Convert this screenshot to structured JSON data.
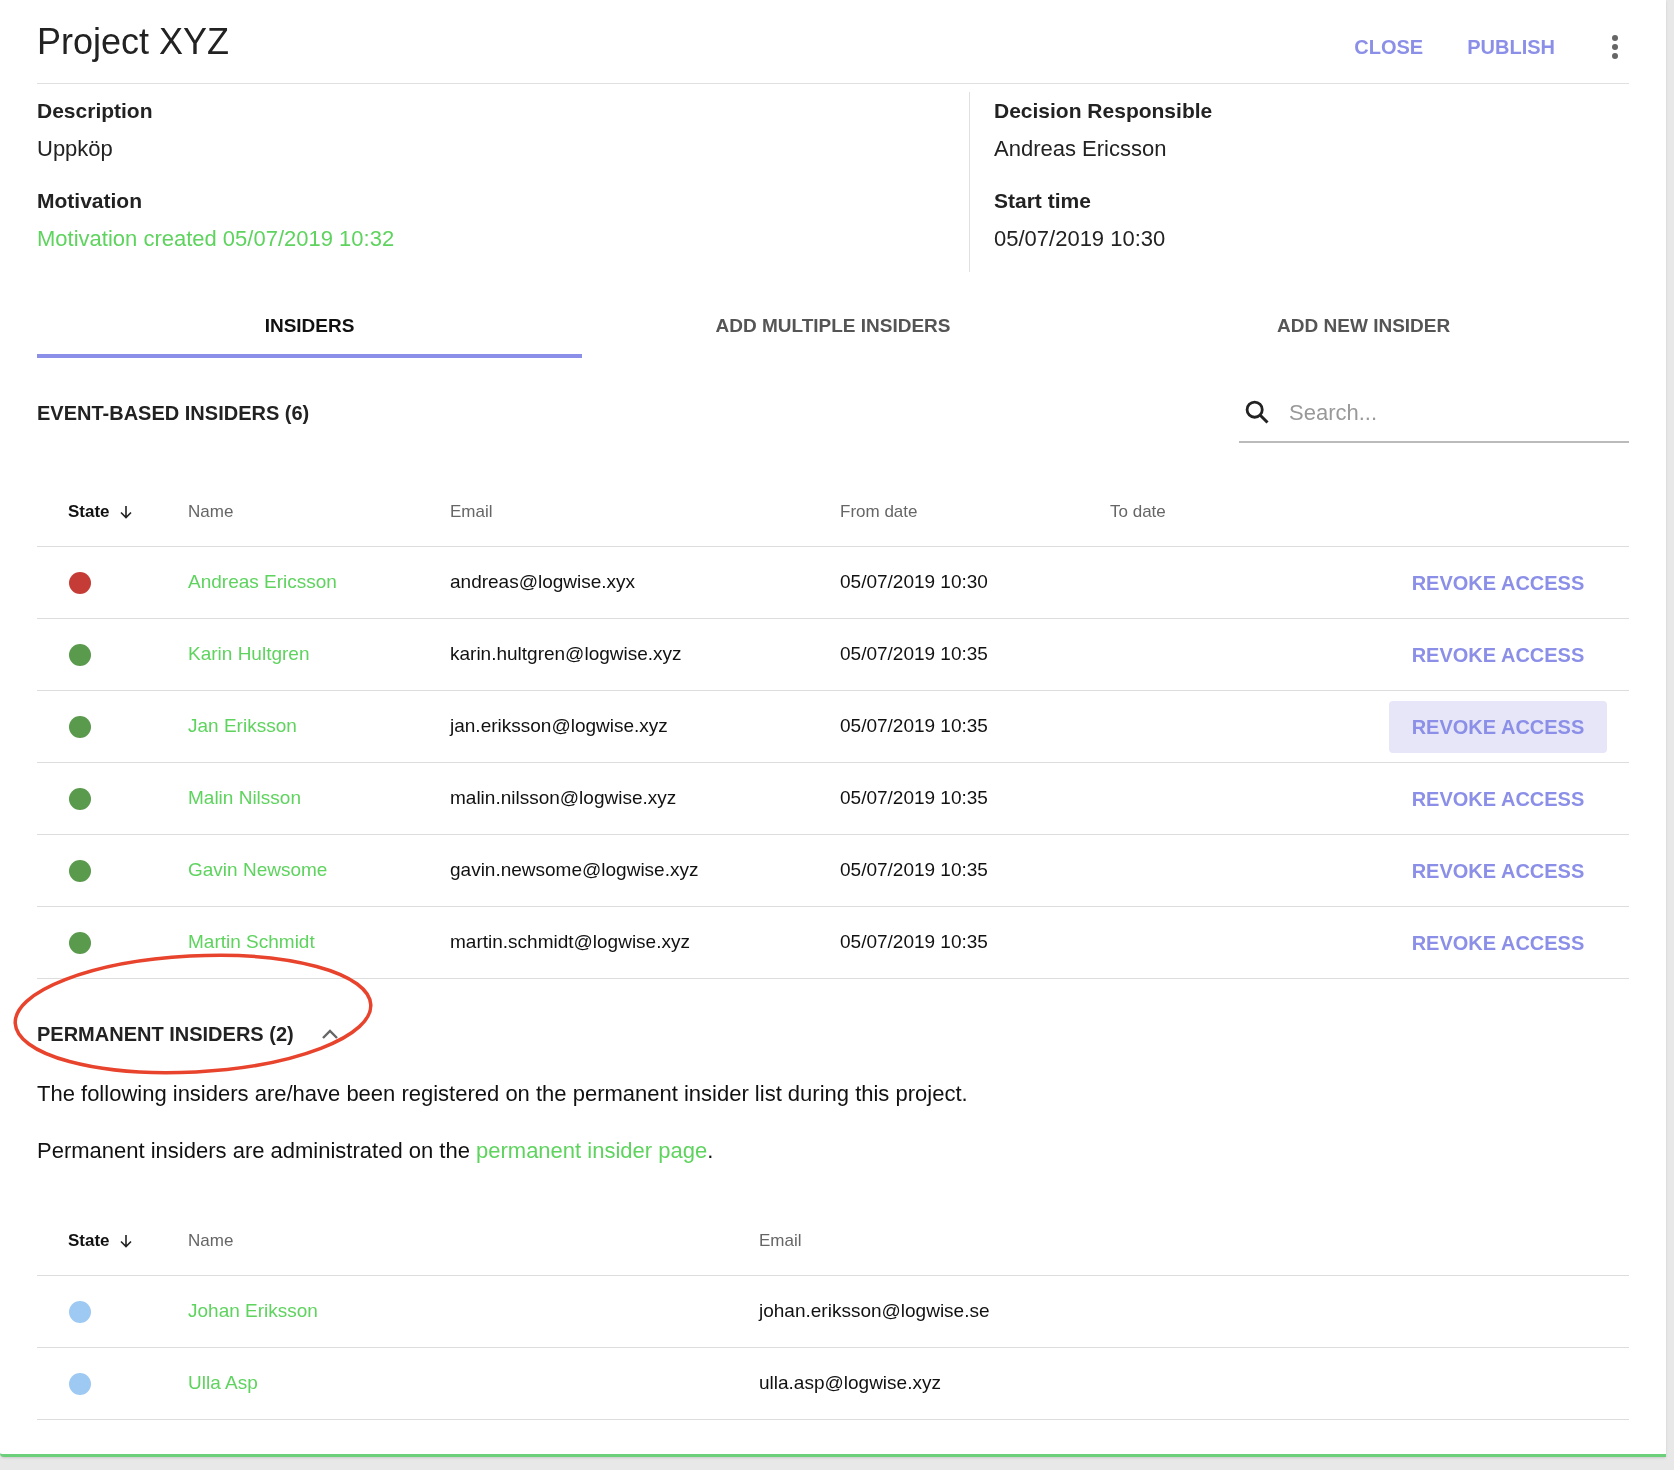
{
  "header": {
    "title": "Project XYZ",
    "actions": [
      "CLOSE",
      "PUBLISH"
    ]
  },
  "details": {
    "left": [
      {
        "label": "Description",
        "value": "Uppköp",
        "kind": "plain"
      },
      {
        "label": "Motivation",
        "value": "Motivation created 05/07/2019 10:32",
        "kind": "link"
      }
    ],
    "right": [
      {
        "label": "Decision Responsible",
        "value": "Andreas Ericsson",
        "kind": "plain"
      },
      {
        "label": "Start time",
        "value": "05/07/2019 10:30",
        "kind": "plain"
      }
    ]
  },
  "tabs": [
    {
      "label": "INSIDERS",
      "selected": true
    },
    {
      "label": "ADD MULTIPLE INSIDERS",
      "selected": false
    },
    {
      "label": "ADD NEW INSIDER",
      "selected": false
    }
  ],
  "event_section": {
    "title": "EVENT-BASED INSIDERS (6)",
    "search": {
      "placeholder": "Search..."
    },
    "columns": [
      "State",
      "Name",
      "Email",
      "From date",
      "To date"
    ],
    "rows": [
      {
        "color": "#c43c35",
        "name": "Andreas Ericsson",
        "email": "andreas@logwise.xyx",
        "from": "05/07/2019 10:30",
        "action": "REVOKE ACCESS",
        "hovered": false
      },
      {
        "color": "#5a9a4c",
        "name": "Karin Hultgren",
        "email": "karin.hultgren@logwise.xyz",
        "from": "05/07/2019 10:35",
        "action": "REVOKE ACCESS",
        "hovered": false
      },
      {
        "color": "#5a9a4c",
        "name": "Jan Eriksson",
        "email": "jan.eriksson@logwise.xyz",
        "from": "05/07/2019 10:35",
        "action": "REVOKE ACCESS",
        "hovered": true
      },
      {
        "color": "#5a9a4c",
        "name": "Malin Nilsson",
        "email": "malin.nilsson@logwise.xyz",
        "from": "05/07/2019 10:35",
        "action": "REVOKE ACCESS",
        "hovered": false
      },
      {
        "color": "#5a9a4c",
        "name": "Gavin Newsome",
        "email": "gavin.newsome@logwise.xyz",
        "from": "05/07/2019 10:35",
        "action": "REVOKE ACCESS",
        "hovered": false
      },
      {
        "color": "#5a9a4c",
        "name": "Martin Schmidt",
        "email": "martin.schmidt@logwise.xyz",
        "from": "05/07/2019 10:35",
        "action": "REVOKE ACCESS",
        "hovered": false
      }
    ]
  },
  "permanent_section": {
    "title": "PERMANENT INSIDERS (2)",
    "expanded": true,
    "paragraph": "The following insiders are/have been registered on the permanent insider list during this project.",
    "note": {
      "before": "Permanent insiders are administrated on the ",
      "link": "permanent insider page",
      "after": "."
    },
    "columns": [
      "State",
      "Name",
      "Email"
    ],
    "rows": [
      {
        "color": "#9ec9f3",
        "name": "Johan Eriksson",
        "email": "johan.eriksson@logwise.se"
      },
      {
        "color": "#9ec9f3",
        "name": "Ulla Asp",
        "email": "ulla.asp@logwise.xyz"
      }
    ]
  }
}
